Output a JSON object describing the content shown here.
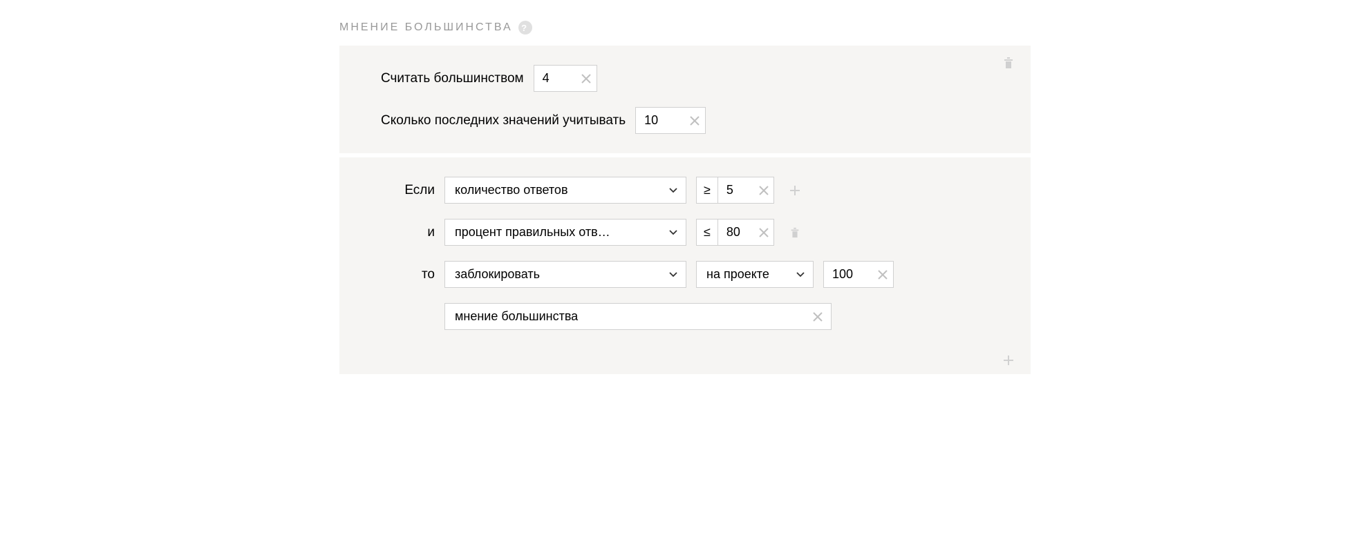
{
  "section": {
    "title": "МНЕНИЕ БОЛЬШИНСТВА"
  },
  "block1": {
    "majority_label": "Считать большинством",
    "majority_value": "4",
    "lastn_label": "Сколько последних значений учитывать",
    "lastn_value": "10"
  },
  "block2": {
    "if_label": "Если",
    "and_label": "и",
    "then_label": "то",
    "cond1_metric": "количество ответов",
    "cond1_op": "≥",
    "cond1_value": "5",
    "cond2_metric": "процент правильных отв…",
    "cond2_op": "≤",
    "cond2_value": "80",
    "action": "заблокировать",
    "scope": "на проекте",
    "duration": "100",
    "reason": "мнение большинства"
  }
}
